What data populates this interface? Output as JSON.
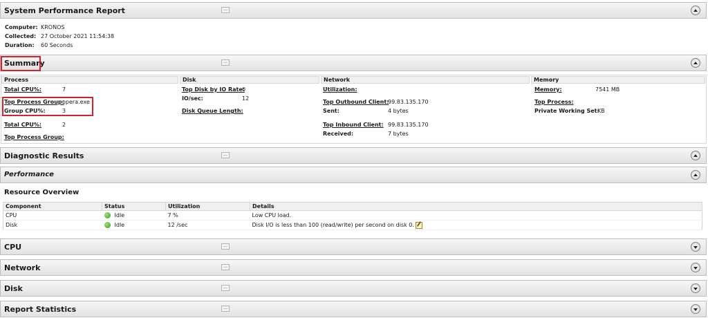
{
  "report": {
    "title": "System Performance Report",
    "computer_label": "Computer:",
    "computer_value": "KRONOS",
    "collected_label": "Collected:",
    "collected_value": "27 October 2021 11:54:38",
    "duration_label": "Duration:",
    "duration_value": "60 Seconds"
  },
  "summary": {
    "title": "Summary",
    "columns": {
      "process": "Process",
      "disk": "Disk",
      "network": "Network",
      "memory": "Memory"
    },
    "process": {
      "total_cpu_label": "Total CPU%:",
      "total_cpu_value": "7",
      "top_group_label": "Top Process Group:",
      "top_group_value": "opera.exe",
      "group_cpu_label": "Group CPU%:",
      "group_cpu_value": "3",
      "total_cpu2_label": "Total CPU%:",
      "total_cpu2_value": "2",
      "top_group2_label": "Top Process Group:"
    },
    "disk": {
      "top_disk_label": "Top Disk by IO Rate:",
      "top_disk_value": "0",
      "io_label": "IO/sec:",
      "io_value": "12",
      "queue_label": "Disk Queue Length:"
    },
    "network": {
      "utilization_label": "Utilization:",
      "top_out_label": "Top Outbound Client:",
      "top_out_value": "99.83.135.170",
      "sent_label": "Sent:",
      "sent_value": "4 bytes",
      "top_in_label": "Top Inbound Client:",
      "top_in_value": "99.83.135.170",
      "received_label": "Received:",
      "received_value": "7 bytes"
    },
    "memory": {
      "memory_label": "Memory:",
      "memory_value": "7541 MB",
      "top_process_label": "Top Process:",
      "private_ws_label": "Private Working Set:",
      "private_ws_value": "KB"
    }
  },
  "sections": {
    "diagnostic": "Diagnostic Results",
    "performance": "Performance",
    "cpu": "CPU",
    "network": "Network",
    "disk": "Disk",
    "report_statistics": "Report Statistics"
  },
  "resource_overview": {
    "title": "Resource Overview",
    "headers": [
      "Component",
      "Status",
      "Utilization",
      "Details"
    ],
    "rows": [
      [
        "CPU",
        "Idle",
        "7 %",
        "Low CPU load."
      ],
      [
        "Disk",
        "Idle",
        "12 /sec",
        "Disk I/O is less than 100 (read/write) per second on disk 0."
      ]
    ]
  },
  "colors": {
    "highlight": "#d9202a",
    "status_ok": "#3c9a21"
  },
  "icons": {
    "toggle_expanded": "collapse-up-icon",
    "toggle_collapsed": "expand-down-icon",
    "status": "green-status-icon",
    "note": "edit-note-icon"
  }
}
